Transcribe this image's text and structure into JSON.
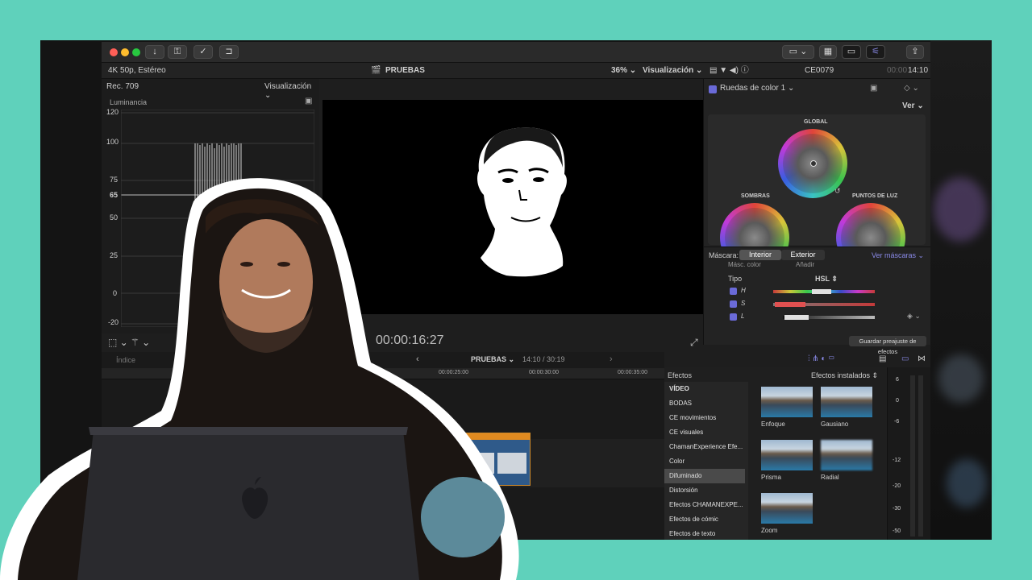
{
  "window": {
    "project_format": "4K 50p, Estéreo",
    "project_name": "PRUEBAS",
    "zoom": "36%",
    "view_label": "Visualización",
    "clip_name": "CE0079",
    "clip_time_prefix": "00:00",
    "clip_time": "14:10"
  },
  "scopes": {
    "standard": "Rec. 709",
    "view_label": "Visualización",
    "title": "Luminancia",
    "ticks": [
      "120",
      "100",
      "75",
      "65",
      "50",
      "25",
      "0",
      "-20"
    ]
  },
  "viewer": {
    "timecode": "00:00:16:27"
  },
  "inspector": {
    "effect_name": "Ruedas de color 1",
    "view_label": "Ver",
    "wheels": [
      "GLOBAL",
      "SOMBRAS",
      "PUNTOS DE LUZ"
    ],
    "mask_label": "Máscara:",
    "mask_inside": "Interior",
    "mask_outside": "Exterior",
    "see_masks": "Ver máscaras",
    "color_mask": "Másc. color",
    "add_label": "Añadir",
    "type_label": "Tipo",
    "type_value": "HSL",
    "channels": [
      "H",
      "S",
      "L"
    ],
    "save_preset": "Guardar preajuste de efectos"
  },
  "timeline": {
    "index_label": "Índice",
    "project_name": "PRUEBAS",
    "position": "14:10 / 30:19",
    "ruler": [
      "00:00:25:00",
      "00:00:30:00",
      "00:00:35:00"
    ]
  },
  "effects": {
    "title": "Efectos",
    "installed": "Efectos instalados",
    "categories": [
      "VÍDEO",
      "BODAS",
      "CE movimientos",
      "CE visuales",
      "ChamanExperience Efe...",
      "Color",
      "Difuminado",
      "Distorsión",
      "Efectos CHAMANEXPE...",
      "Efectos de cómic",
      "Efectos de texto"
    ],
    "items": [
      "Enfoque",
      "Gausiano",
      "Prisma",
      "Radial",
      "Zoom"
    ],
    "meter_ticks": [
      "6",
      "0",
      "-6",
      "-12",
      "-20",
      "-30",
      "-50"
    ]
  },
  "colors": {
    "background": "#5fd1bb",
    "accent": "#6a6ad8"
  }
}
